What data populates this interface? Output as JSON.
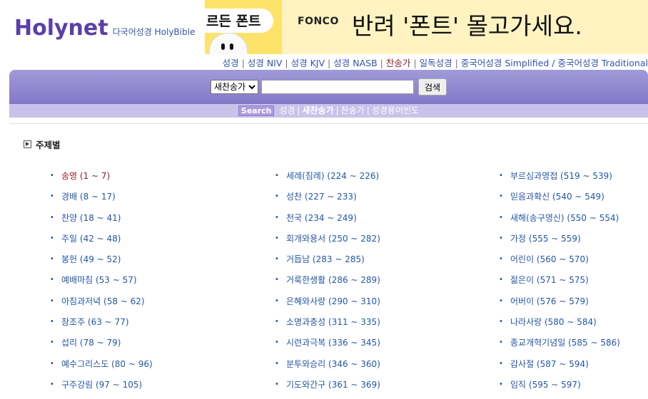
{
  "logo": {
    "main": "Holynet",
    "sub": "다국어성경 HolyBible"
  },
  "banner": {
    "left_text": "르든 폰트",
    "brand": "FONCO",
    "text": "반려 '폰트' 몰고가세요."
  },
  "topnav": {
    "items": [
      "성경",
      "성경 NIV",
      "성경 KJV",
      "성경 NASB",
      "찬송가",
      "일독성경",
      "중국어성경 Simplified / 중국어성경 Traditional"
    ]
  },
  "search": {
    "select_value": "새찬송가",
    "input_value": "",
    "button_label": "검색"
  },
  "subnav": {
    "badge": "Search",
    "items": [
      "성경",
      "새찬송가",
      "찬송가",
      "성경용어빈도"
    ]
  },
  "section": {
    "title": "주제별"
  },
  "columns": [
    [
      "송영 (1 ~ 7)",
      "경배 (8 ~ 17)",
      "찬양 (18 ~ 41)",
      "주일 (42 ~ 48)",
      "봉헌 (49 ~ 52)",
      "예배마침 (53 ~ 57)",
      "아침과저녁 (58 ~ 62)",
      "창조주 (63 ~ 77)",
      "섭리 (78 ~ 79)",
      "예수그리스도 (80 ~ 96)",
      "구주강림 (97 ~ 105)"
    ],
    [
      "세례(침례) (224 ~ 226)",
      "성찬 (227 ~ 233)",
      "천국 (234 ~ 249)",
      "회개와용서 (250 ~ 282)",
      "거듭남 (283 ~ 285)",
      "거룩한생활 (286 ~ 289)",
      "은혜와사랑 (290 ~ 310)",
      "소명과충성 (311 ~ 335)",
      "시련과극복 (336 ~ 345)",
      "분투와승리 (346 ~ 360)",
      "기도와간구 (361 ~ 369)"
    ],
    [
      "부르심과영접 (519 ~ 539)",
      "믿음과확신 (540 ~ 549)",
      "새해(송구영신) (550 ~ 554)",
      "가정 (555 ~ 559)",
      "어린이 (560 ~ 570)",
      "젊은이 (571 ~ 575)",
      "어버이 (576 ~ 579)",
      "나라사랑 (580 ~ 584)",
      "종교개혁기념일 (585 ~ 586)",
      "감사절 (587 ~ 594)",
      "임직 (595 ~ 597)"
    ]
  ]
}
